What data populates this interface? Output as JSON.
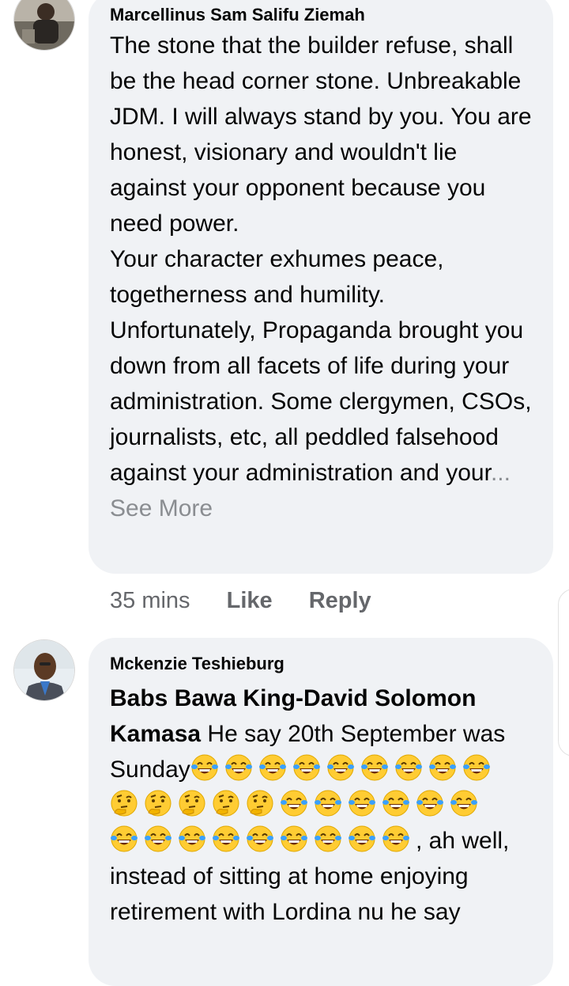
{
  "comments": [
    {
      "author": "Marcellinus Sam Salifu Ziemah",
      "avatar_icon": "profile-photo-man",
      "paragraph1": "The stone that the builder refuse, shall be the head corner stone. Unbreakable JDM. I will always stand by you. You are honest, visionary and wouldn't lie against your opponent because you need power.",
      "paragraph2": "Your character exhumes peace, togetherness and humility. Unfortunately, Propaganda brought you down from all facets of life during your administration. Some clergymen, CSOs, journalists, etc, all peddled falsehood against your administration and your",
      "ellipsis": "...",
      "see_more": "See More",
      "time": "35 mins",
      "like_label": "Like",
      "reply_label": "Reply"
    },
    {
      "author": "Mckenzie Teshieburg",
      "avatar_icon": "profile-photo-man-suit",
      "mention": "Babs Bawa King-David Solomon Kamasa",
      "text_a": " He say 20th September was",
      "text_b": "Sunday",
      "emoji_row1": [
        "laugh",
        "laugh",
        "laugh",
        "laugh",
        "laugh",
        "laugh",
        "laugh",
        "laugh",
        "laugh"
      ],
      "emoji_row2": [
        "thinking",
        "thinking",
        "thinking",
        "thinking",
        "thinking",
        "laugh",
        "laugh",
        "laugh",
        "laugh",
        "laugh",
        "laugh"
      ],
      "emoji_row3": [
        "laugh",
        "laugh",
        "laugh",
        "laugh",
        "laugh",
        "laugh",
        "laugh",
        "laugh",
        "laugh"
      ],
      "after_emoji": ", ah well,",
      "text_c": "instead of sitting at home enjoying retirement with Lordina nu he say"
    }
  ],
  "colors": {
    "bubble": "#f0f2f5",
    "meta": "#65676b",
    "see_more": "#8a8d91",
    "emoji_face": "#ffcc33",
    "emoji_tear": "#3aa0ff"
  }
}
